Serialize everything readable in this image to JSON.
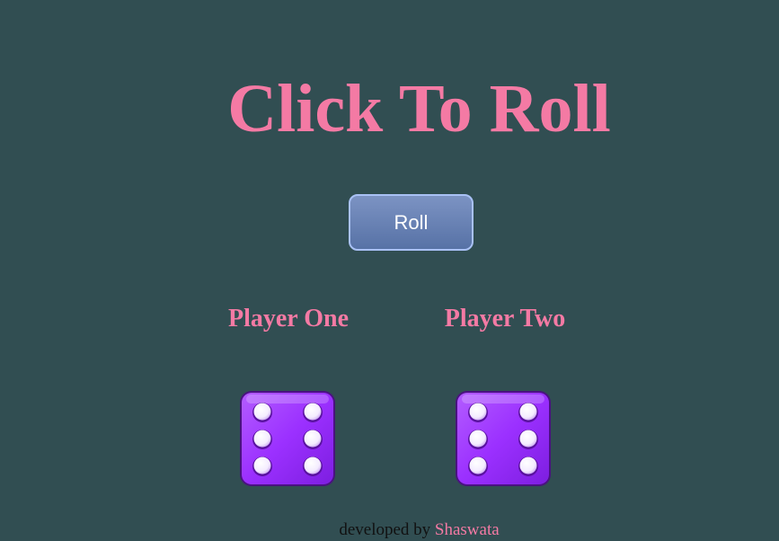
{
  "title": "Click To Roll",
  "roll_button": {
    "label": "Roll"
  },
  "players": [
    {
      "name": "Player One",
      "die_value": 6
    },
    {
      "name": "Player Two",
      "die_value": 6
    }
  ],
  "footer": {
    "prefix": "developed by",
    "author": "Shaswata"
  },
  "colors": {
    "background": "#314e52",
    "accent_pink": "#f47aa4",
    "die_purple": "#9b30ff",
    "button_blue": "#6a83b6"
  }
}
